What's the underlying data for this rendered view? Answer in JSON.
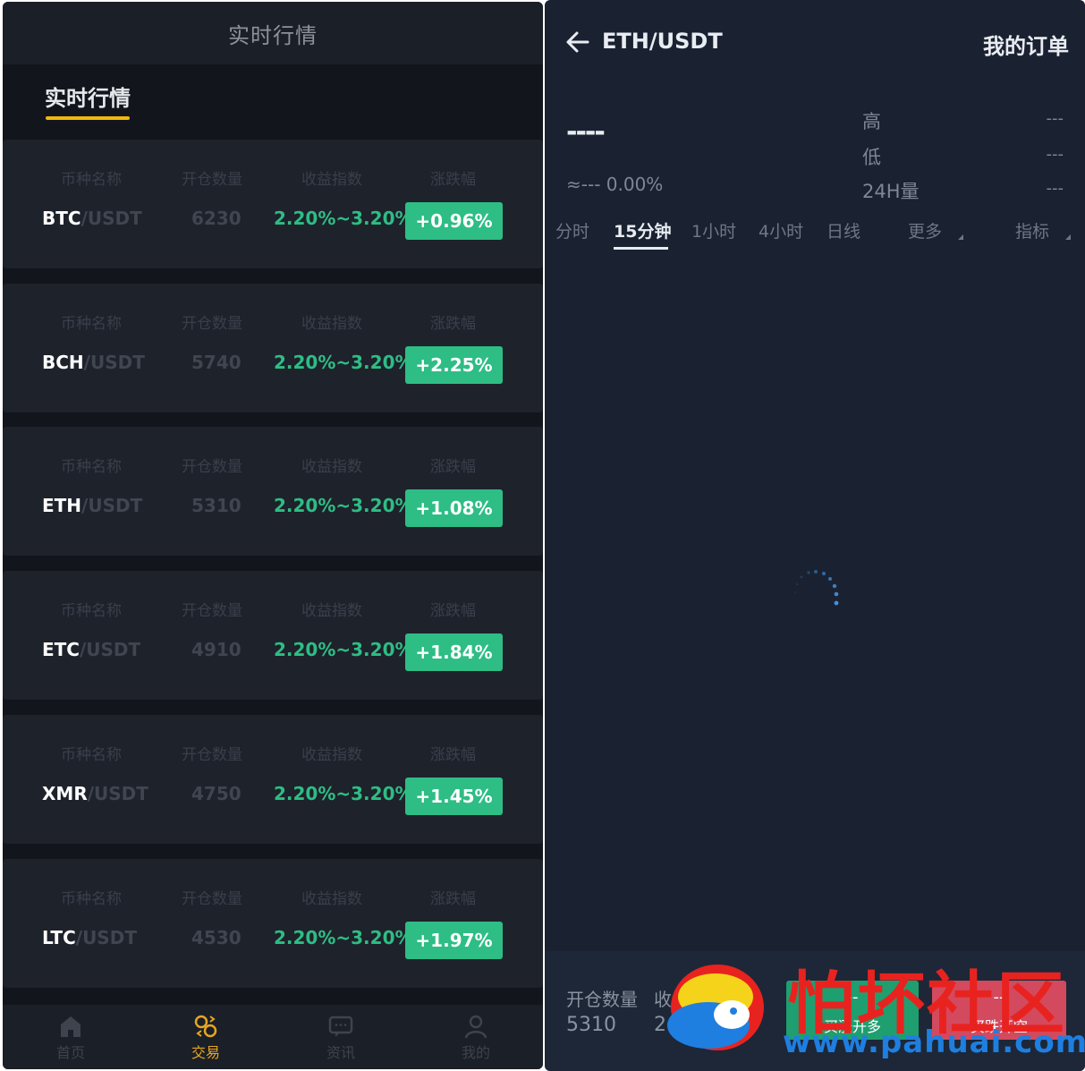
{
  "left": {
    "header_title": "实时行情",
    "active_tab": "实时行情",
    "column_headers": [
      "币种名称",
      "开仓数量",
      "收益指数",
      "涨跌幅"
    ],
    "rows": [
      {
        "base": "BTC",
        "quote": "/USDT",
        "qty": "6230",
        "index": "2.20%~3.20%",
        "change": "+0.96%"
      },
      {
        "base": "BCH",
        "quote": "/USDT",
        "qty": "5740",
        "index": "2.20%~3.20%",
        "change": "+2.25%"
      },
      {
        "base": "ETH",
        "quote": "/USDT",
        "qty": "5310",
        "index": "2.20%~3.20%",
        "change": "+1.08%"
      },
      {
        "base": "ETC",
        "quote": "/USDT",
        "qty": "4910",
        "index": "2.20%~3.20%",
        "change": "+1.84%"
      },
      {
        "base": "XMR",
        "quote": "/USDT",
        "qty": "4750",
        "index": "2.20%~3.20%",
        "change": "+1.45%"
      },
      {
        "base": "LTC",
        "quote": "/USDT",
        "qty": "4530",
        "index": "2.20%~3.20%",
        "change": "+1.97%"
      }
    ],
    "nav": [
      {
        "label": "首页",
        "icon": "home-icon",
        "active": false
      },
      {
        "label": "交易",
        "icon": "trade-icon",
        "active": true
      },
      {
        "label": "资讯",
        "icon": "news-icon",
        "active": false
      },
      {
        "label": "我的",
        "icon": "user-icon",
        "active": false
      }
    ]
  },
  "right": {
    "pair": "ETH/USDT",
    "orders_link": "我的订单",
    "price": "----",
    "approx": "≈--- 0.00%",
    "stats": [
      {
        "label": "高",
        "value": "---"
      },
      {
        "label": "低",
        "value": "---"
      },
      {
        "label": "24H量",
        "value": "---"
      }
    ],
    "periods": [
      "分时",
      "15分钟",
      "1小时",
      "4小时",
      "日线",
      "更多",
      "指标"
    ],
    "active_period": "15分钟",
    "footer": {
      "qty_label": "开仓数量",
      "qty_value": "5310",
      "index_label": "收",
      "index_value": "2",
      "long_value": "--",
      "long_label": "买涨开多",
      "short_value": "--",
      "short_label": "买跌开空"
    }
  },
  "watermark": {
    "text": "怕坏社区",
    "url": "www.pahuai.com"
  },
  "colors": {
    "up_green": "#2ebd85",
    "accent_yellow": "#f0b90b",
    "nav_active": "#e6a623",
    "short_red": "#d34a5e"
  }
}
